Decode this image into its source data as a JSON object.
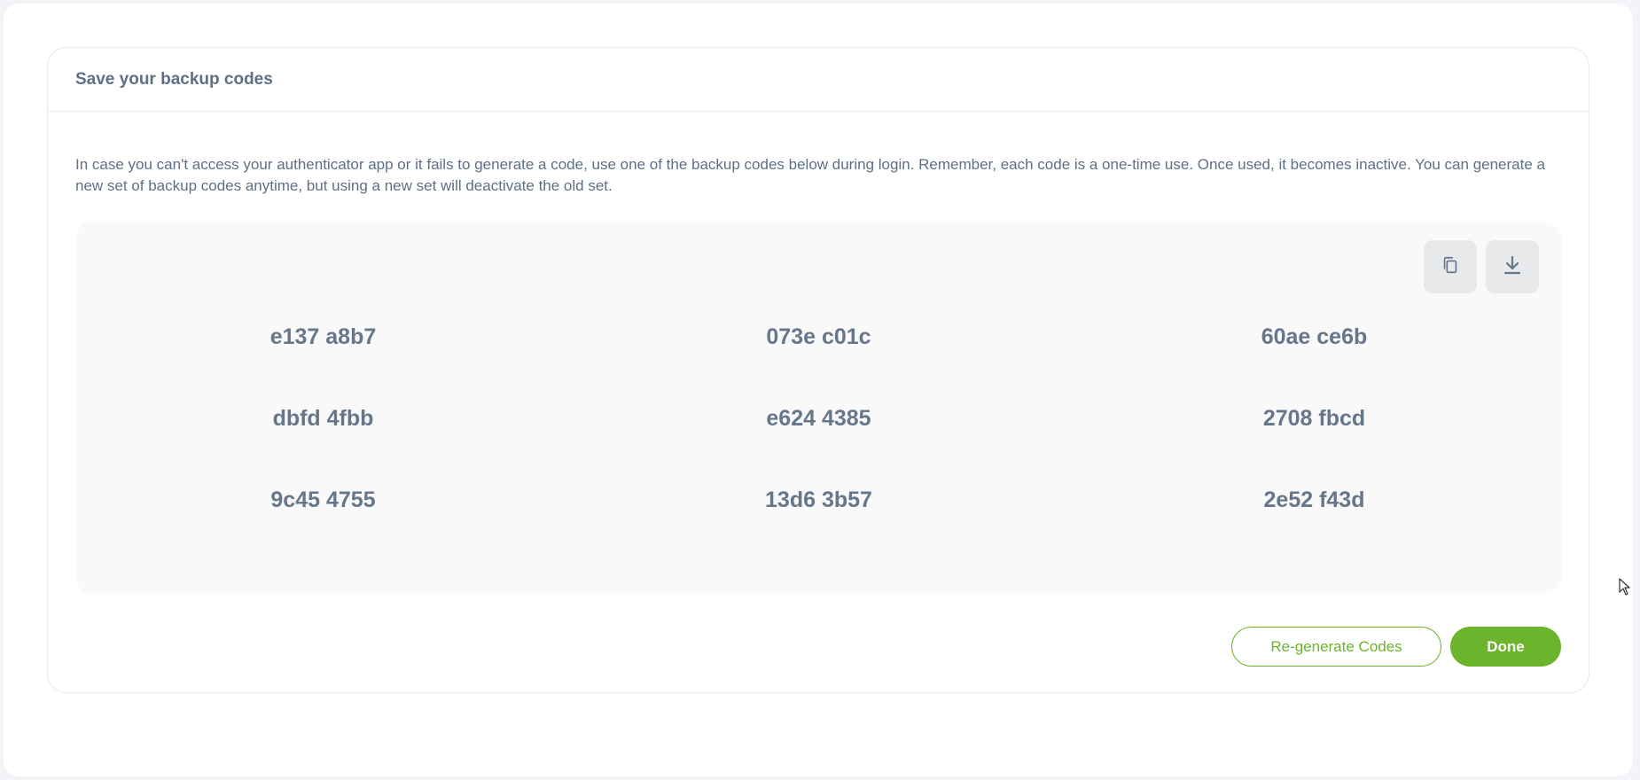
{
  "card": {
    "title": "Save your backup codes",
    "description": "In case you can't access your authenticator app or it fails to generate a code, use one of the backup codes below during login. Remember, each code is a one-time use. Once used, it becomes inactive. You can generate a new set of backup codes anytime, but using a new set will deactivate the old set."
  },
  "codes": {
    "row1": [
      "e137 a8b7",
      "073e c01c",
      "60ae ce6b"
    ],
    "row2": [
      "dbfd 4fbb",
      "e624 4385",
      "2708 fbcd"
    ],
    "row3": [
      "9c45 4755",
      "13d6 3b57",
      "2e52 f43d"
    ]
  },
  "icons": {
    "copy": "copy-icon",
    "download": "download-icon"
  },
  "actions": {
    "regenerate_label": "Re-generate Codes",
    "done_label": "Done"
  },
  "colors": {
    "accent": "#6cb42c",
    "text": "#5f6f86",
    "code_text": "#66768b",
    "panel_bg": "#f9f9fa"
  }
}
